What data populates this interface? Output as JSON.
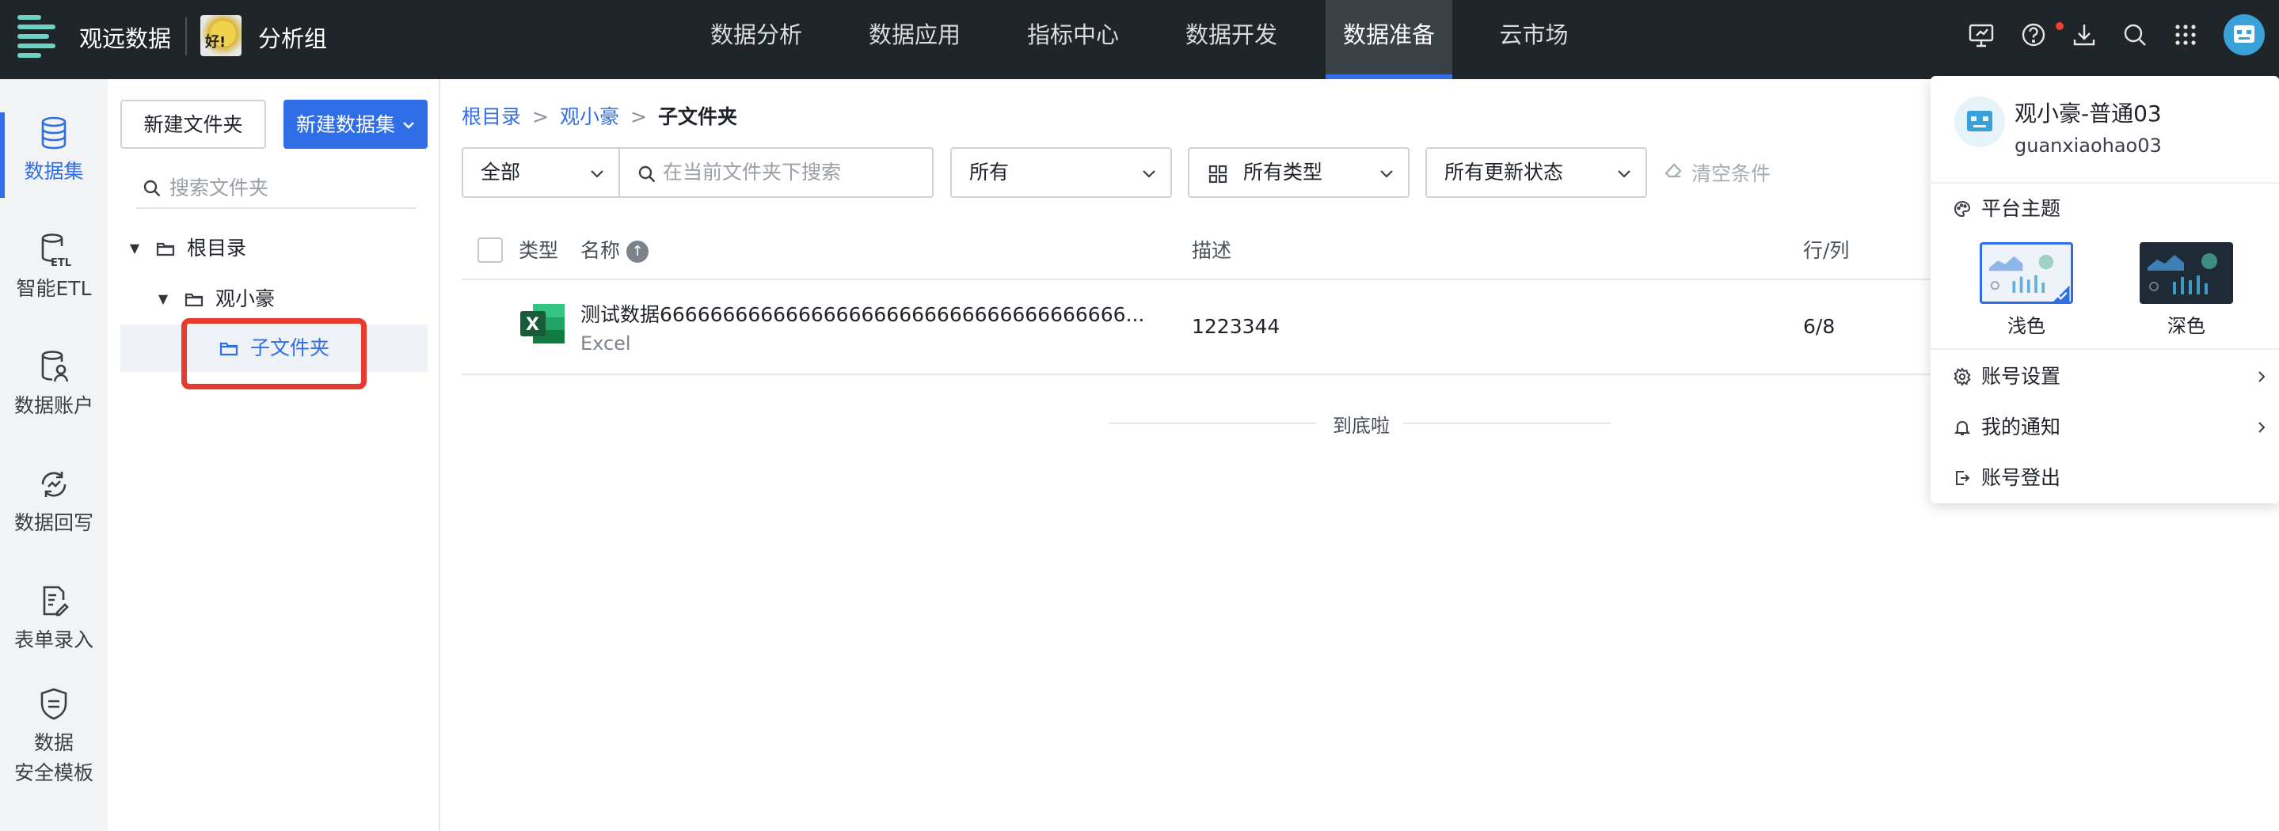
{
  "app": {
    "brand": "观远数据",
    "team_name": "分析组",
    "team_avatar_text": "好!"
  },
  "nav": [
    {
      "label": "数据分析",
      "active": false
    },
    {
      "label": "数据应用",
      "active": false
    },
    {
      "label": "指标中心",
      "active": false
    },
    {
      "label": "数据开发",
      "active": false
    },
    {
      "label": "数据准备",
      "active": true
    },
    {
      "label": "云市场",
      "active": false
    }
  ],
  "top_icons": [
    "monitor-icon",
    "help-icon",
    "download-icon",
    "search-icon",
    "apps-grid-icon",
    "user-avatar"
  ],
  "rail": [
    {
      "label": "数据集",
      "icon": "database-icon",
      "active": true
    },
    {
      "label": "智能ETL",
      "icon": "etl-icon",
      "active": false
    },
    {
      "label": "数据账户",
      "icon": "data-account-icon",
      "active": false
    },
    {
      "label": "数据回写",
      "icon": "writeback-icon",
      "active": false
    },
    {
      "label": "表单录入",
      "icon": "form-entry-icon",
      "active": false
    },
    {
      "label_line1": "数据",
      "label_line2": "安全模板",
      "icon": "shield-template-icon",
      "active": false
    }
  ],
  "tree": {
    "new_folder": "新建文件夹",
    "new_dataset": "新建数据集",
    "search_placeholder": "搜索文件夹",
    "nodes": [
      {
        "label": "根目录",
        "depth": 0
      },
      {
        "label": "观小豪",
        "depth": 1
      },
      {
        "label": "子文件夹",
        "depth": 2,
        "selected": true
      }
    ]
  },
  "breadcrumb": {
    "root": "根目录",
    "parent": "观小豪",
    "current": "子文件夹",
    "sep": ">"
  },
  "filters": {
    "scope": "全部",
    "search_placeholder": "在当前文件夹下搜索",
    "owner": "所有",
    "type": "所有类型",
    "update_status": "所有更新状态",
    "clear": "清空条件"
  },
  "table": {
    "headers": {
      "type": "类型",
      "name": "名称",
      "desc": "描述",
      "rowcol": "行/列"
    },
    "rows": [
      {
        "name": "测试数据6666666666666666666666666666666666666...",
        "type": "Excel",
        "desc": "1223344",
        "rowcol": "6/8"
      }
    ],
    "end_text": "到底啦"
  },
  "user_menu": {
    "name": "观小豪-普通03",
    "account": "guanxiaohao03",
    "theme_title": "平台主题",
    "theme_light": "浅色",
    "theme_dark": "深色",
    "selected_theme": "浅色",
    "account_settings": "账号设置",
    "notifications": "我的通知",
    "logout": "账号登出"
  },
  "colors": {
    "accent": "#2f6ee6",
    "topbar": "#1f2529",
    "highlight": "#e63b2e",
    "excel_green": "#1e7145"
  }
}
